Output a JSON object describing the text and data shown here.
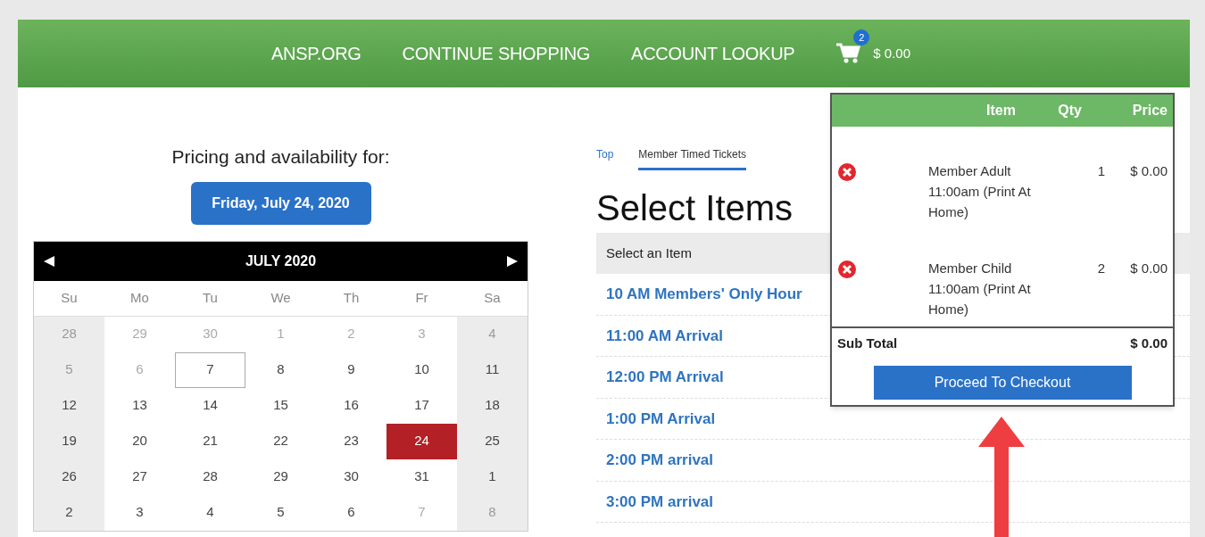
{
  "header": {
    "links": [
      "ANSP.ORG",
      "CONTINUE SHOPPING",
      "ACCOUNT LOOKUP"
    ],
    "cart": {
      "count": "2",
      "total": "$ 0.00"
    }
  },
  "pricing": {
    "title": "Pricing and availability for:",
    "date_button": "Friday, July 24, 2020"
  },
  "calendar": {
    "month": "JULY 2020",
    "weekdays": [
      "Su",
      "Mo",
      "Tu",
      "We",
      "Th",
      "Fr",
      "Sa"
    ],
    "weeks": [
      [
        {
          "day": "28",
          "muted": true,
          "today": false,
          "selected": false
        },
        {
          "day": "29",
          "muted": true,
          "today": false,
          "selected": false
        },
        {
          "day": "30",
          "muted": true,
          "today": false,
          "selected": false
        },
        {
          "day": "1",
          "muted": true,
          "today": false,
          "selected": false
        },
        {
          "day": "2",
          "muted": true,
          "today": false,
          "selected": false
        },
        {
          "day": "3",
          "muted": true,
          "today": false,
          "selected": false
        },
        {
          "day": "4",
          "muted": true,
          "today": false,
          "selected": false
        }
      ],
      [
        {
          "day": "5",
          "muted": true,
          "today": false,
          "selected": false
        },
        {
          "day": "6",
          "muted": true,
          "today": false,
          "selected": false
        },
        {
          "day": "7",
          "muted": false,
          "today": true,
          "selected": false
        },
        {
          "day": "8",
          "muted": false,
          "today": false,
          "selected": false
        },
        {
          "day": "9",
          "muted": false,
          "today": false,
          "selected": false
        },
        {
          "day": "10",
          "muted": false,
          "today": false,
          "selected": false
        },
        {
          "day": "11",
          "muted": false,
          "today": false,
          "selected": false
        }
      ],
      [
        {
          "day": "12",
          "muted": false,
          "today": false,
          "selected": false
        },
        {
          "day": "13",
          "muted": false,
          "today": false,
          "selected": false
        },
        {
          "day": "14",
          "muted": false,
          "today": false,
          "selected": false
        },
        {
          "day": "15",
          "muted": false,
          "today": false,
          "selected": false
        },
        {
          "day": "16",
          "muted": false,
          "today": false,
          "selected": false
        },
        {
          "day": "17",
          "muted": false,
          "today": false,
          "selected": false
        },
        {
          "day": "18",
          "muted": false,
          "today": false,
          "selected": false
        }
      ],
      [
        {
          "day": "19",
          "muted": false,
          "today": false,
          "selected": false
        },
        {
          "day": "20",
          "muted": false,
          "today": false,
          "selected": false
        },
        {
          "day": "21",
          "muted": false,
          "today": false,
          "selected": false
        },
        {
          "day": "22",
          "muted": false,
          "today": false,
          "selected": false
        },
        {
          "day": "23",
          "muted": false,
          "today": false,
          "selected": false
        },
        {
          "day": "24",
          "muted": false,
          "today": false,
          "selected": true
        },
        {
          "day": "25",
          "muted": false,
          "today": false,
          "selected": false
        }
      ],
      [
        {
          "day": "26",
          "muted": false,
          "today": false,
          "selected": false
        },
        {
          "day": "27",
          "muted": false,
          "today": false,
          "selected": false
        },
        {
          "day": "28",
          "muted": false,
          "today": false,
          "selected": false
        },
        {
          "day": "29",
          "muted": false,
          "today": false,
          "selected": false
        },
        {
          "day": "30",
          "muted": false,
          "today": false,
          "selected": false
        },
        {
          "day": "31",
          "muted": false,
          "today": false,
          "selected": false
        },
        {
          "day": "1",
          "muted": false,
          "today": false,
          "selected": false
        }
      ],
      [
        {
          "day": "2",
          "muted": false,
          "today": false,
          "selected": false
        },
        {
          "day": "3",
          "muted": false,
          "today": false,
          "selected": false
        },
        {
          "day": "4",
          "muted": false,
          "today": false,
          "selected": false
        },
        {
          "day": "5",
          "muted": false,
          "today": false,
          "selected": false
        },
        {
          "day": "6",
          "muted": false,
          "today": false,
          "selected": false
        },
        {
          "day": "7",
          "muted": true,
          "today": false,
          "selected": false
        },
        {
          "day": "8",
          "muted": true,
          "today": false,
          "selected": false
        }
      ]
    ]
  },
  "tabs": [
    {
      "label": "Top",
      "selected": false
    },
    {
      "label": "Member Timed Tickets",
      "selected": true
    }
  ],
  "heading": "Select Items",
  "table": {
    "header": "Select an Item",
    "rows": [
      "10 AM Members' Only Hour",
      "11:00 AM Arrival",
      "12:00 PM Arrival",
      "1:00 PM Arrival",
      "2:00 PM arrival",
      "3:00 PM arrival"
    ]
  },
  "cart_popup": {
    "columns": [
      "Item",
      "Qty",
      "Price"
    ],
    "items": [
      {
        "name": "Member Adult 11:00am (Print At Home)",
        "qty": "1",
        "price": "$ 0.00"
      },
      {
        "name": "Member Child 11:00am (Print At Home)",
        "qty": "2",
        "price": "$ 0.00"
      }
    ],
    "subtotal_label": "Sub Total",
    "subtotal": "$ 0.00",
    "checkout": "Proceed To Checkout"
  }
}
